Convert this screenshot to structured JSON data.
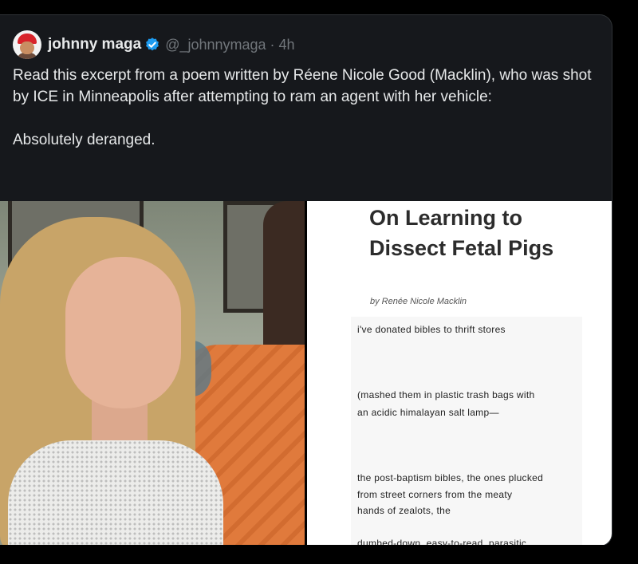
{
  "tweet": {
    "author_name": "johnny maga",
    "handle_time": "@_johnnymaga · 4h",
    "text_lines": [
      "Read this excerpt from a poem written by Réene Nicole Good (Macklin), who was shot by ICE in Minneapolis after attempting to ram an agent with her vehicle:",
      "Absolutely deranged."
    ]
  },
  "poem_image": {
    "title": "On Learning to Dissect Fetal Pigs",
    "byline": "by Renée Nicole Macklin",
    "lines": [
      "i've donated bibles to thrift stores",
      "(mashed them in plastic trash bags with",
      "an acidic himalayan salt lamp—",
      "the post-baptism bibles, the ones plucked",
      "from street corners from the meaty",
      "hands of zealots, the",
      "dumbed-down, easy-to-read, parasitic"
    ]
  },
  "colors": {
    "background": "#000000",
    "card": "#16181c",
    "text": "#e7e9ea",
    "muted": "#71767b",
    "verified": "#1d9bf0"
  },
  "icons": {
    "verified": "verified-badge-icon",
    "avatar": "avatar-red-cap"
  }
}
